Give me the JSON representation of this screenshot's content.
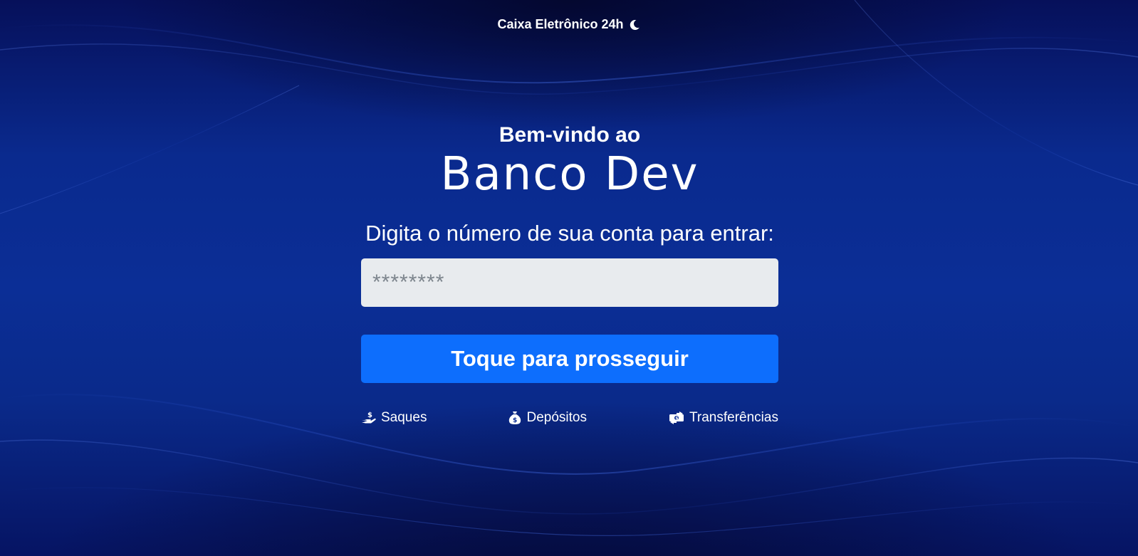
{
  "header": {
    "title": "Caixa Eletrônico 24h",
    "theme_icon": "moon-icon"
  },
  "hero": {
    "welcome": "Bem-vindo ao",
    "bank_name": "Banco Dev"
  },
  "login": {
    "prompt": "Digita o número de sua conta para entrar:",
    "account_placeholder": "********",
    "account_value": "",
    "submit_label": "Toque para prosseguir"
  },
  "services": [
    {
      "label": "Saques",
      "icon": "hand-holding-dollar-icon"
    },
    {
      "label": "Depósitos",
      "icon": "money-bag-icon"
    },
    {
      "label": "Transferências",
      "icon": "money-transfer-icon"
    }
  ],
  "colors": {
    "background_dark": "#061463",
    "background_mid": "#0b2e96",
    "input_bg": "#e8ebee",
    "button_primary": "#0d6efd",
    "text": "#ffffff"
  }
}
